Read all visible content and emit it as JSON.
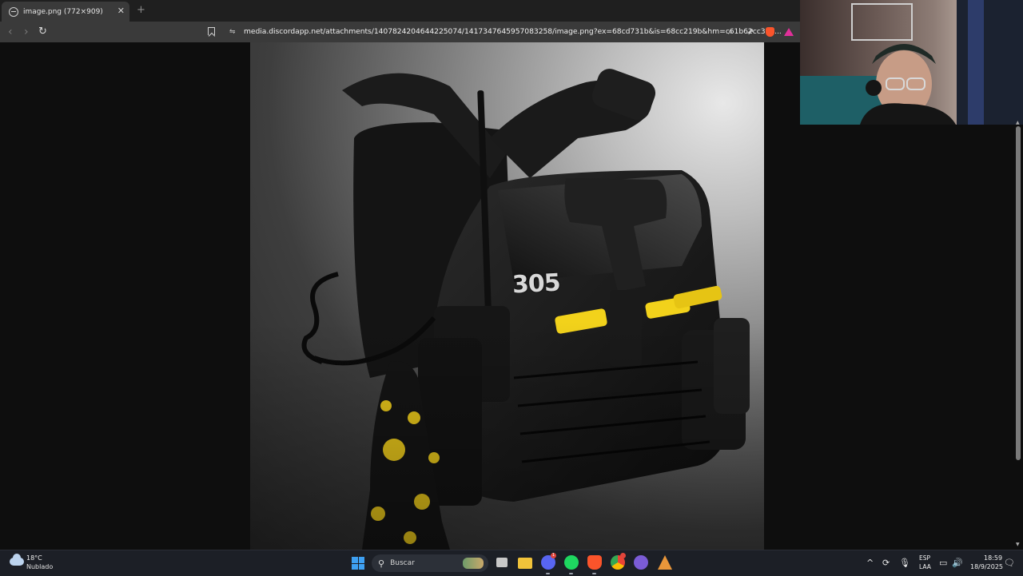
{
  "browser": {
    "tab_title": "image.png (772×909)",
    "tab_close": "✕",
    "new_tab": "+",
    "back": "‹",
    "forward": "›",
    "reload": "↻",
    "url": "media.discordapp.net/attachments/1407824204644225074/1417347645957083258/image.png?ex=68cd731b&is=68cc219b&hm=c61b62cc369...",
    "site_controls": "⇋",
    "zoom_icon": "⌕",
    "share_icon": "⇗"
  },
  "image": {
    "vest_number": "305"
  },
  "taskbar": {
    "weather_temp": "18°C",
    "weather_condition": "Nublado",
    "search_label": "Buscar",
    "search_glyph": "⚲",
    "discord_badge": "1",
    "tray_chevron": "^",
    "tray_sync": "⟳",
    "tray_mic": "🎙",
    "lang_line1": "ESP",
    "lang_line2": "LAA",
    "tray_display": "▭",
    "tray_volume": "🔊",
    "tray_notify": "🗨",
    "time": "18:59",
    "date": "18/9/2025"
  },
  "colors": {
    "tab_strip": "#1f1f1f",
    "toolbar": "#3a3a3a",
    "taskbar": "#1c1f26",
    "accent_yellow": "#f2d21b",
    "windows_blue": "#3ea0f2"
  }
}
